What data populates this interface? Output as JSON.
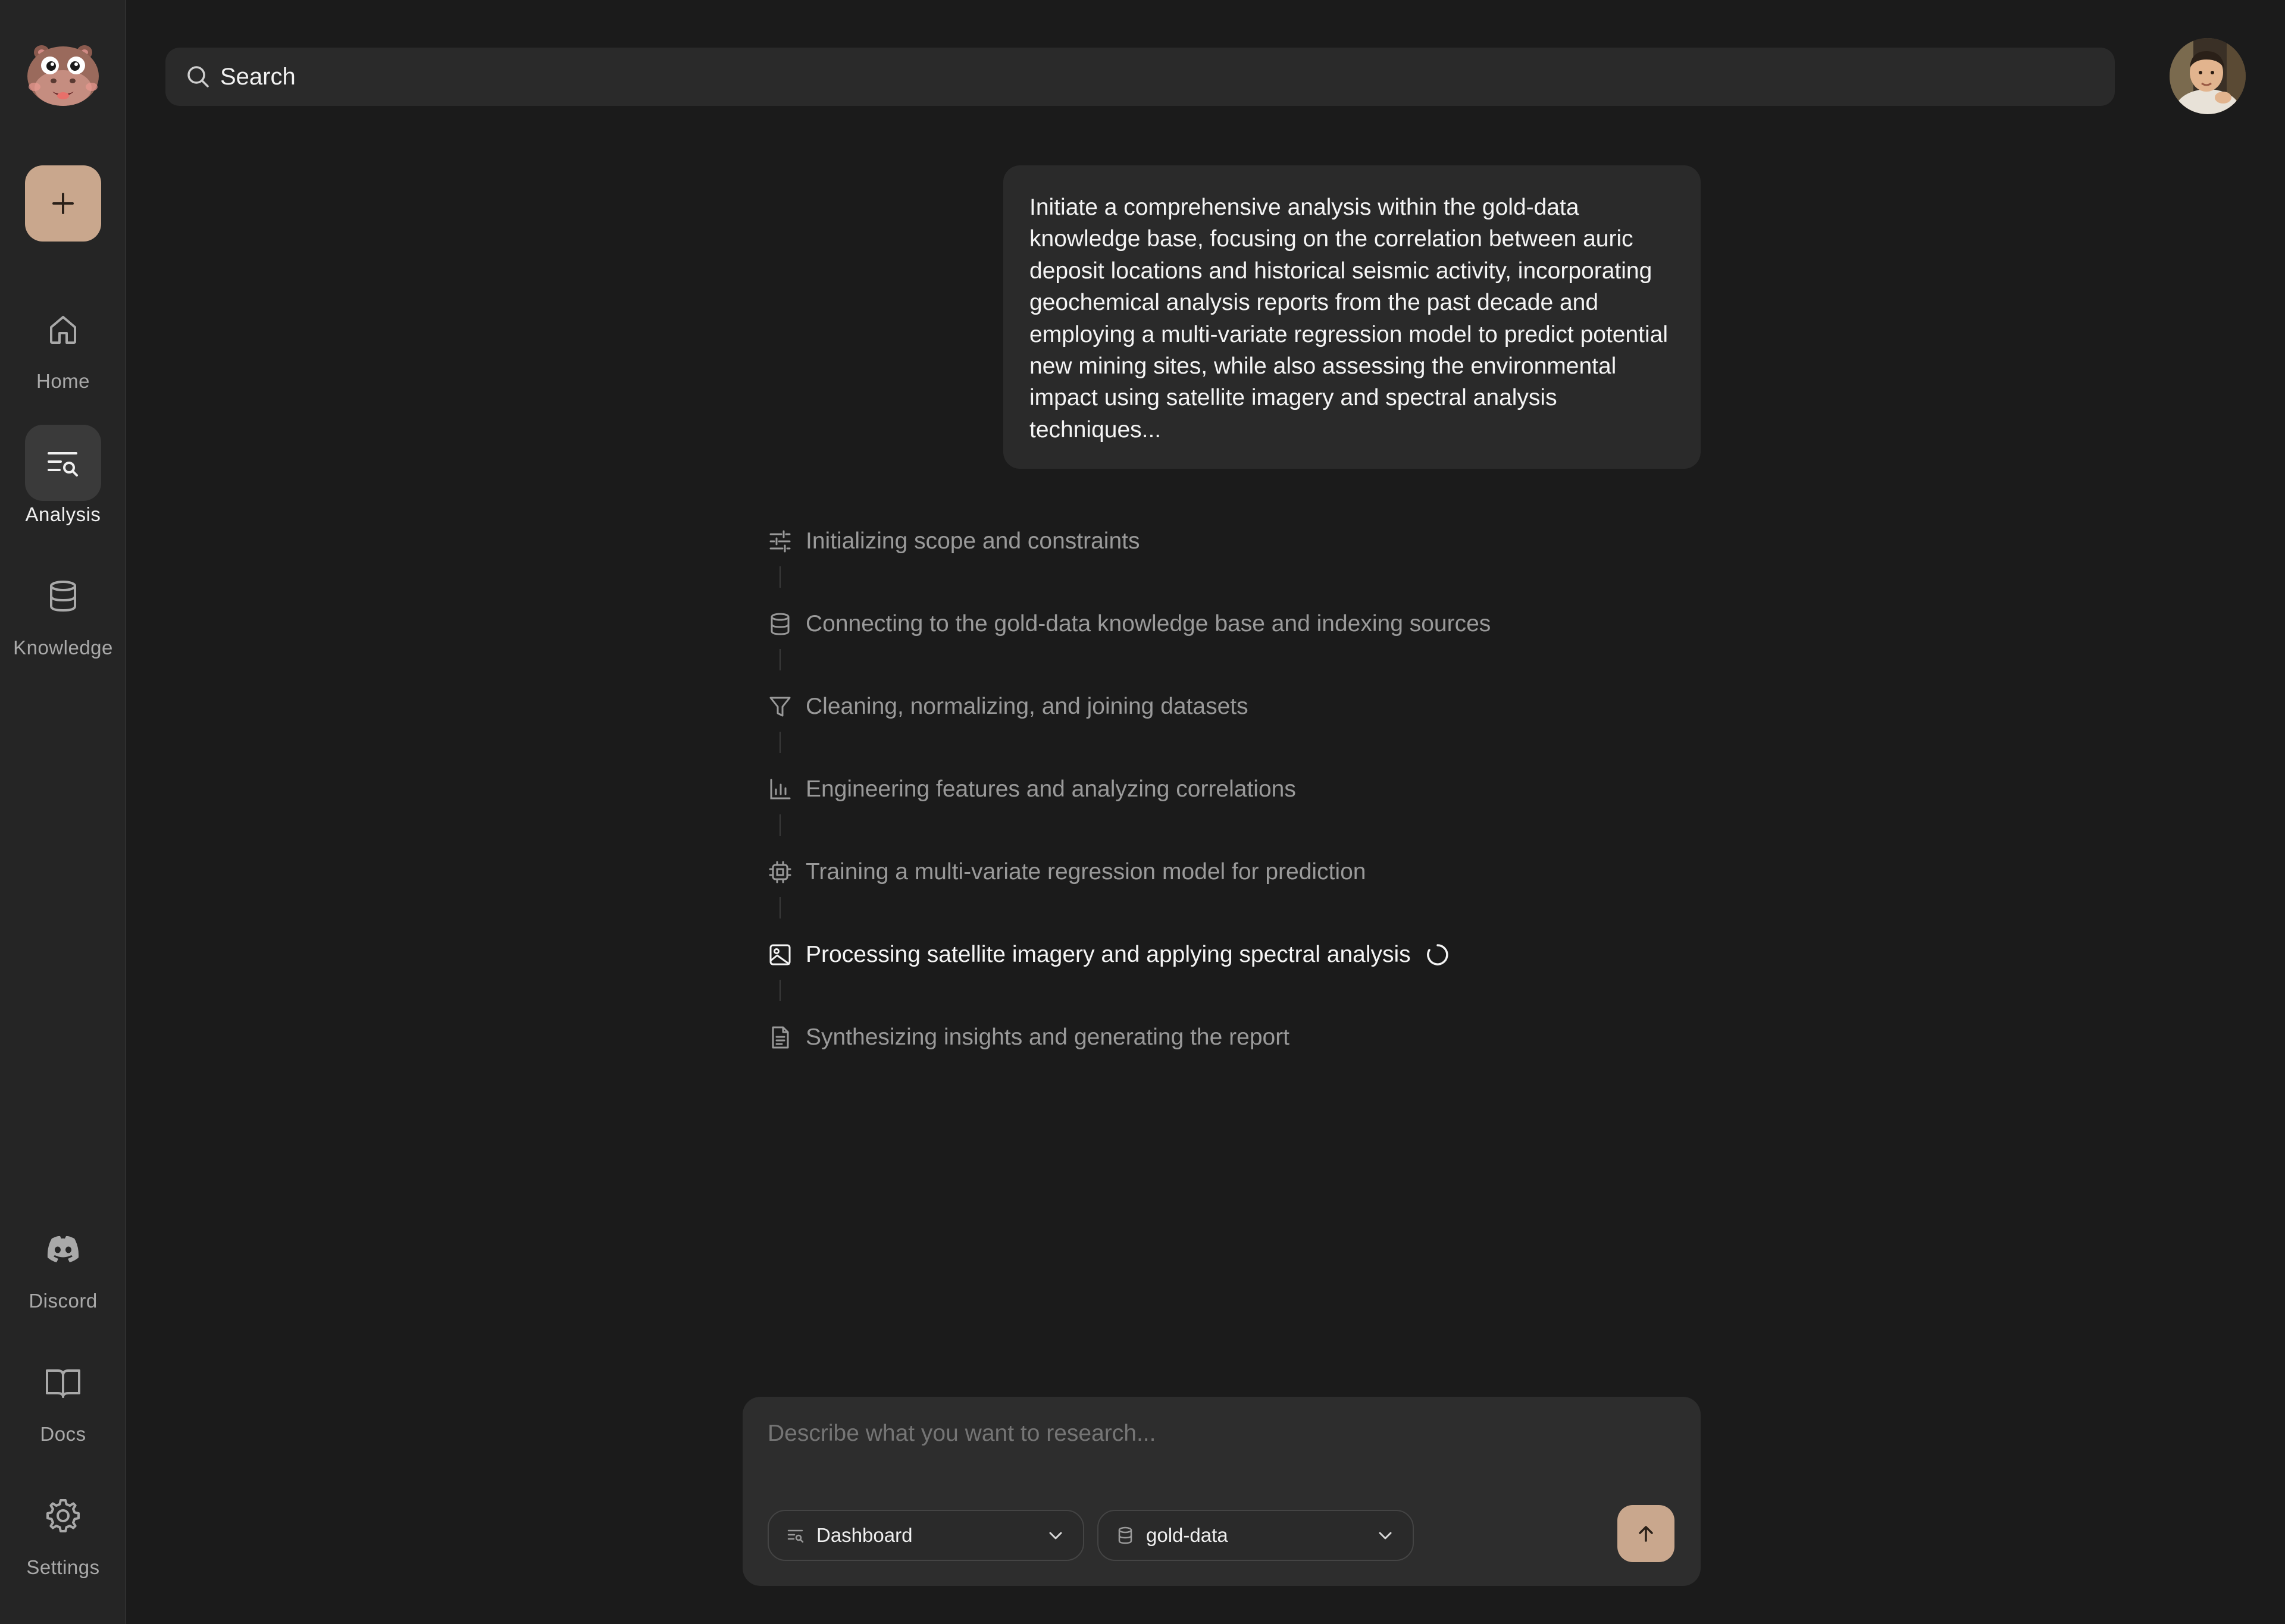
{
  "sidebar": {
    "logo_icon": "hippo-logo",
    "new_button_icon": "plus-icon",
    "items": [
      {
        "label": "Home",
        "icon": "home-icon",
        "active": false
      },
      {
        "label": "Analysis",
        "icon": "analysis-icon",
        "active": true
      },
      {
        "label": "Knowledge",
        "icon": "database-icon",
        "active": false
      }
    ],
    "bottom_items": [
      {
        "label": "Discord",
        "icon": "discord-icon"
      },
      {
        "label": "Docs",
        "icon": "book-icon"
      },
      {
        "label": "Settings",
        "icon": "gear-icon"
      }
    ]
  },
  "header": {
    "search_placeholder": "Search",
    "avatar_icon": "user-avatar"
  },
  "message": {
    "text": "Initiate a comprehensive analysis within the gold-data knowledge base, focusing on the correlation between auric deposit locations and historical seismic activity, incorporating geochemical analysis reports from the past decade and employing a multi-variate regression model to predict potential new mining sites, while also assessing the environmental impact using satellite imagery and spectral analysis techniques..."
  },
  "steps": [
    {
      "label": "Initializing scope and constraints",
      "icon": "sliders-icon",
      "status": "done"
    },
    {
      "label": "Connecting to the gold-data knowledge base and indexing sources",
      "icon": "database-icon",
      "status": "done"
    },
    {
      "label": "Cleaning, normalizing, and joining datasets",
      "icon": "filter-icon",
      "status": "done"
    },
    {
      "label": "Engineering features and analyzing correlations",
      "icon": "bar-chart-icon",
      "status": "done"
    },
    {
      "label": "Training a multi-variate regression model for prediction",
      "icon": "cpu-icon",
      "status": "done"
    },
    {
      "label": "Processing satellite imagery and applying spectral analysis",
      "icon": "image-icon",
      "status": "in-progress"
    },
    {
      "label": "Synthesizing insights and generating the report",
      "icon": "document-icon",
      "status": "pending"
    }
  ],
  "composer": {
    "placeholder": "Describe what you want to research...",
    "mode_select": {
      "value": "Dashboard",
      "icon": "analysis-icon"
    },
    "source_select": {
      "value": "gold-data",
      "icon": "database-icon"
    },
    "send_icon": "arrow-up-icon"
  },
  "colors": {
    "background": "#1b1b1b",
    "sidebar": "#252525",
    "accent": "#c9a78d",
    "panel": "#2a2a2a"
  }
}
